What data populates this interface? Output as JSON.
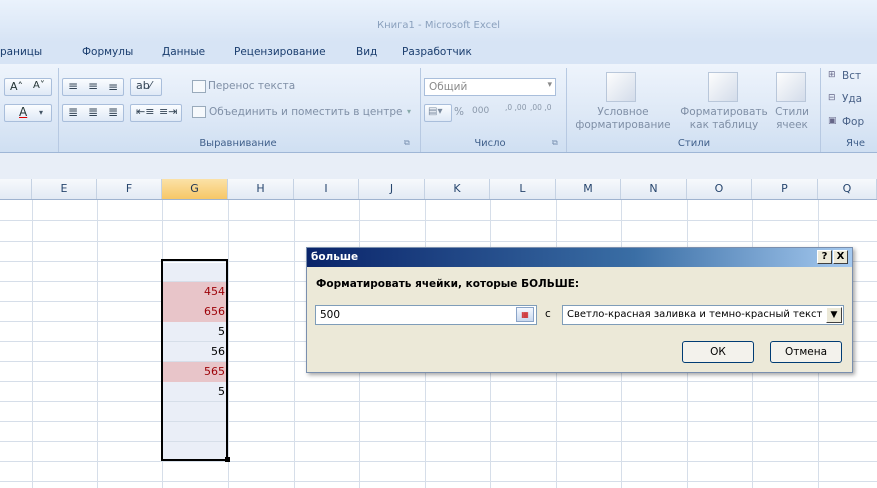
{
  "window": {
    "title": "Книга1 - Microsoft Excel"
  },
  "ribbon": {
    "tabs": [
      "раницы",
      "Формулы",
      "Данные",
      "Рецензирование",
      "Вид",
      "Разработчик"
    ],
    "alignment": {
      "wrap_text": "Перенос текста",
      "merge_center": "Объединить и поместить в центре",
      "group_label": "Выравнивание"
    },
    "number": {
      "format_value": "Общий",
      "percent": "%",
      "thousands": "000",
      "inc_decimal": ",0 ,00",
      "dec_decimal": ",00 ,0",
      "group_label": "Число"
    },
    "styles": {
      "conditional_1": "Условное",
      "conditional_2": "форматирование",
      "table_1": "Форматировать",
      "table_2": "как таблицу",
      "cell_styles_1": "Стили",
      "cell_styles_2": "ячеек",
      "group_label": "Стили"
    },
    "cells": {
      "insert": "Вст",
      "delete": "Уда",
      "format": "Фор",
      "group_label": "Яче"
    }
  },
  "sheet": {
    "columns": [
      "E",
      "F",
      "G",
      "H",
      "I",
      "J",
      "K",
      "L",
      "M",
      "N",
      "O",
      "P",
      "Q"
    ],
    "selected_column": "G",
    "cells": [
      {
        "value": "454",
        "highlight": true
      },
      {
        "value": "656",
        "highlight": true
      },
      {
        "value": "5",
        "highlight": false
      },
      {
        "value": "56",
        "highlight": false
      },
      {
        "value": "565",
        "highlight": true
      },
      {
        "value": "5",
        "highlight": false
      }
    ],
    "highlight_fill": "#e8c5c9",
    "highlight_text": "#9c0006"
  },
  "dialog": {
    "title": "больше",
    "help": "?",
    "close": "X",
    "prompt": "Форматировать ячейки, которые БОЛЬШЕ:",
    "value": "500",
    "with_label": "с",
    "format_option": "Светло-красная заливка и темно-красный текст",
    "ok": "ОК",
    "cancel": "Отмена"
  }
}
